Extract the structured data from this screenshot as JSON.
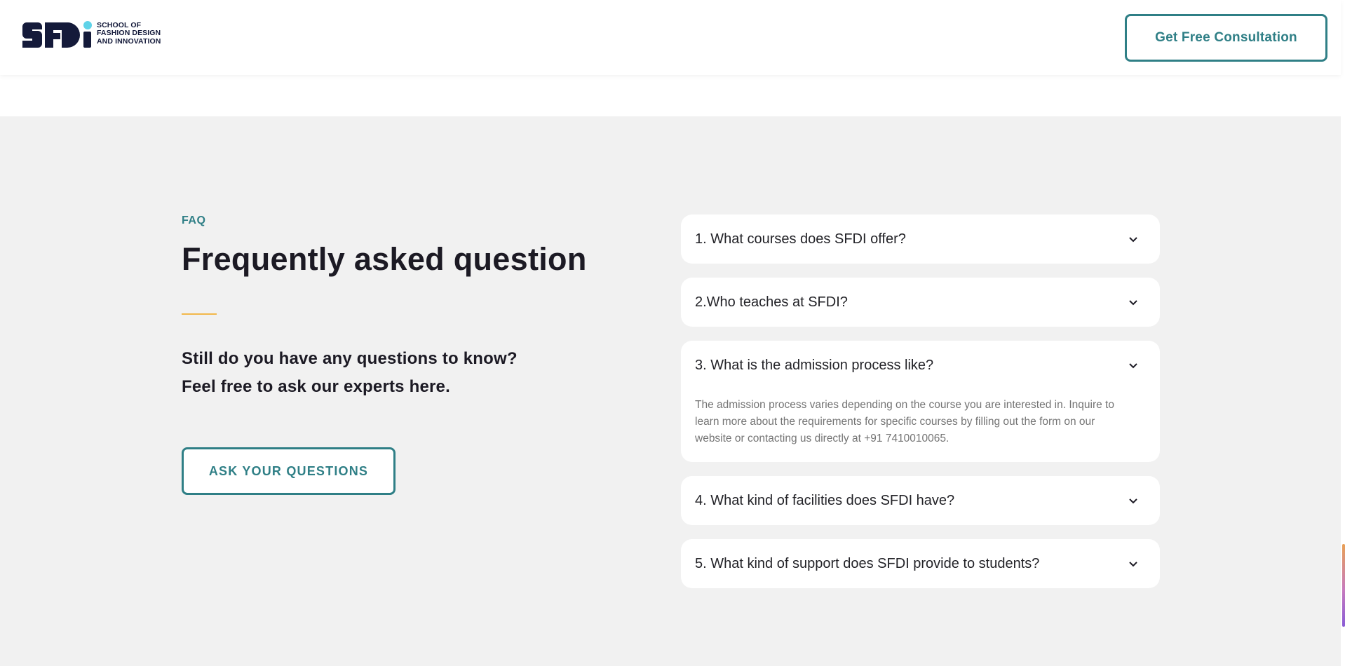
{
  "header": {
    "logo_text_line1": "SCHOOL OF",
    "logo_text_line2": "FASHION DESIGN",
    "logo_text_line3": "AND INNOVATION",
    "cta_label": "Get Free Consultation"
  },
  "faq": {
    "eyebrow": "FAQ",
    "heading": "Frequently asked question",
    "sub_line1": "Still do you have any questions to know?",
    "sub_line2": "Feel free to ask our experts here.",
    "ask_button": "ASK YOUR QUESTIONS",
    "items": [
      {
        "question": "1. What courses does SFDI offer?",
        "expanded": false
      },
      {
        "question": "2.Who teaches at SFDI?",
        "expanded": false
      },
      {
        "question": "3. What is the admission process like?",
        "expanded": true,
        "answer": "The admission process varies depending on the course you are interested in. Inquire to learn more about the requirements for specific courses by filling out the form on our website or contacting us directly at +91 7410010065."
      },
      {
        "question": "4. What kind of facilities does SFDI have?",
        "expanded": false
      },
      {
        "question": "5. What kind of support does SFDI provide to students?",
        "expanded": false
      }
    ]
  },
  "colors": {
    "accent_teal": "#2f7f86",
    "accent_yellow": "#f2b84b",
    "logo_navy": "#141a3a",
    "logo_dot": "#5fd3e8",
    "section_bg": "#f1f1f1"
  },
  "icons": {
    "chevron": "chevron-down-icon"
  }
}
